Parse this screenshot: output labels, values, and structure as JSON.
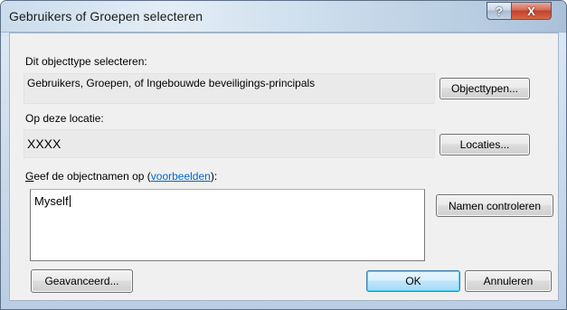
{
  "window": {
    "title": "Gebruikers of Groepen selecteren",
    "help_glyph": "?",
    "close_glyph": "X"
  },
  "object_type": {
    "label": "Dit objecttype selecteren:",
    "value": "Gebruikers, Groepen, of Ingebouwde beveiligings-principals",
    "button": "Objecttypen..."
  },
  "location": {
    "label": "Op deze locatie:",
    "value": "XXXX",
    "button": "Locaties..."
  },
  "names": {
    "label_accel": "G",
    "label_rest": "eef de objectnamen op (",
    "link": "voorbeelden",
    "label_end": "):",
    "value": "Myself",
    "check_button": "Namen controleren"
  },
  "footer": {
    "advanced_button": "Geavanceerd...",
    "ok_button": "OK",
    "cancel_button": "Annuleren"
  },
  "colors": {
    "link": "#0066cc",
    "close_button": "#c2412a"
  }
}
